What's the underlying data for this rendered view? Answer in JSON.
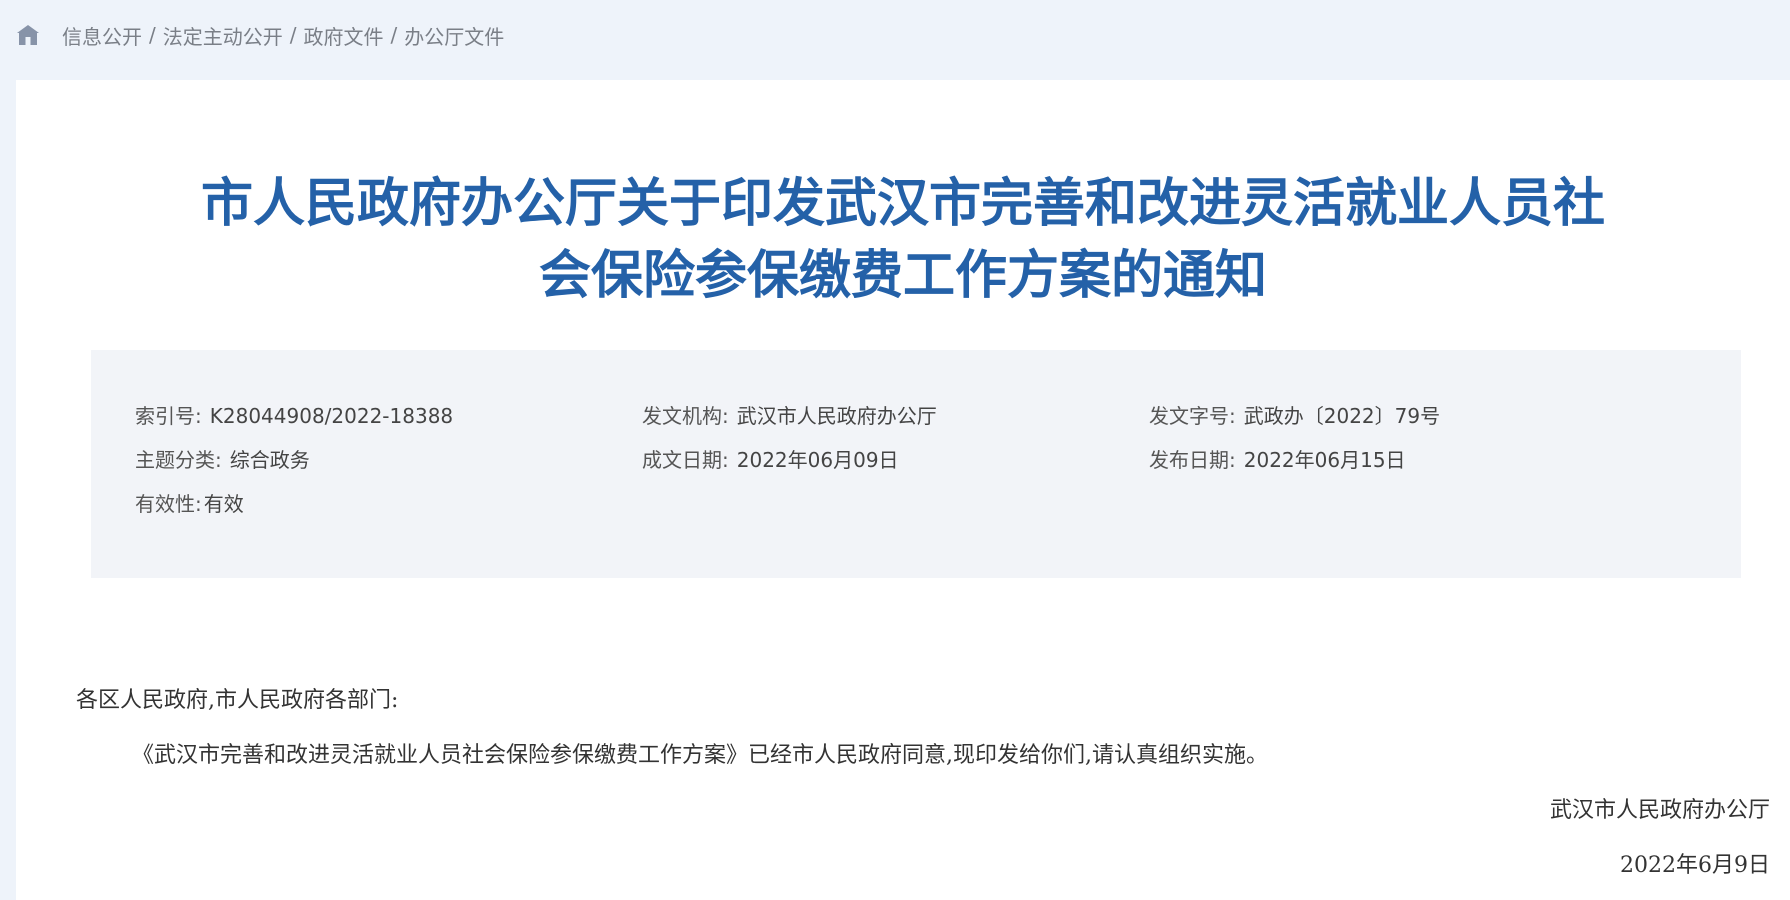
{
  "breadcrumb": {
    "home_icon": "home-icon",
    "items": [
      "信息公开",
      "法定主动公开",
      "政府文件",
      "办公厅文件"
    ],
    "separator": "/"
  },
  "document": {
    "title_line1": "市人民政府办公厅关于印发武汉市完善和改进灵活就业人员社",
    "title_line2": "会保险参保缴费工作方案的通知",
    "meta": {
      "index_label": "索引号:",
      "index_value": "K28044908/2022-18388",
      "issuer_label": "发文机构:",
      "issuer_value": "武汉市人民政府办公厅",
      "doc_number_label": "发文字号:",
      "doc_number_value": "武政办〔2022〕79号",
      "topic_label": "主题分类:",
      "topic_value": "综合政务",
      "written_date_label": "成文日期:",
      "written_date_value": "2022年06月09日",
      "publish_date_label": "发布日期:",
      "publish_date_value": "2022年06月15日",
      "validity_label": "有效性:",
      "validity_value": "有效"
    },
    "salutation": "各区人民政府,市人民政府各部门:",
    "paragraph": "《武汉市完善和改进灵活就业人员社会保险参保缴费工作方案》已经市人民政府同意,现印发给你们,请认真组织实施。",
    "signature_org": "武汉市人民政府办公厅",
    "signature_date": "2022年6月9日"
  },
  "colors": {
    "title": "#2461a8",
    "page_bg": "#eef3fa",
    "meta_bg": "#f2f4f8",
    "breadcrumb_text": "#7a7f87"
  }
}
